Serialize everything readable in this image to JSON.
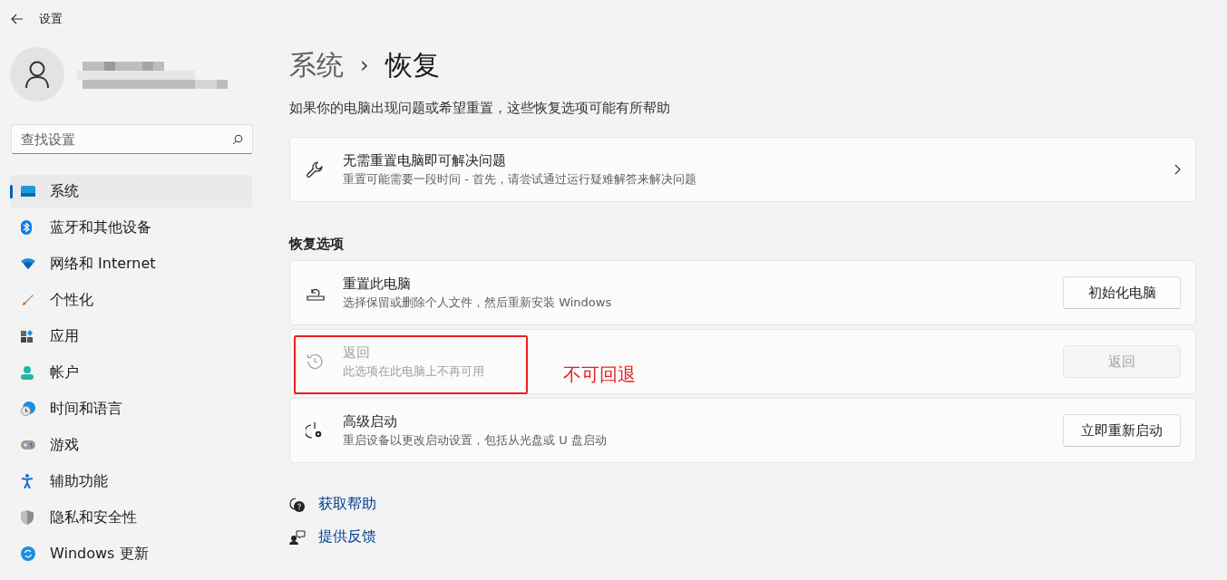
{
  "window": {
    "title": "设置"
  },
  "sidebar": {
    "search": {
      "placeholder": "查找设置"
    },
    "items": [
      {
        "label": "系统",
        "selected": true
      },
      {
        "label": "蓝牙和其他设备",
        "selected": false
      },
      {
        "label": "网络和 Internet",
        "selected": false
      },
      {
        "label": "个性化",
        "selected": false
      },
      {
        "label": "应用",
        "selected": false
      },
      {
        "label": "帐户",
        "selected": false
      },
      {
        "label": "时间和语言",
        "selected": false
      },
      {
        "label": "游戏",
        "selected": false
      },
      {
        "label": "辅助功能",
        "selected": false
      },
      {
        "label": "隐私和安全性",
        "selected": false
      },
      {
        "label": "Windows 更新",
        "selected": false
      }
    ]
  },
  "breadcrumb": {
    "parent": "系统",
    "separator": "›",
    "current": "恢复"
  },
  "description": "如果你的电脑出现问题或希望重置，这些恢复选项可能有所帮助",
  "fix_card": {
    "title": "无需重置电脑即可解决问题",
    "subtitle": "重置可能需要一段时间 - 首先，请尝试通过运行疑难解答来解决问题"
  },
  "section_title": "恢复选项",
  "options": [
    {
      "title": "重置此电脑",
      "subtitle": "选择保留或删除个人文件，然后重新安装 Windows",
      "button": "初始化电脑",
      "disabled": false
    },
    {
      "title": "返回",
      "subtitle": "此选项在此电脑上不再可用",
      "button": "返回",
      "disabled": true,
      "annotation": "不可回退"
    },
    {
      "title": "高级启动",
      "subtitle": "重启设备以更改启动设置，包括从光盘或 U 盘启动",
      "button": "立即重新启动",
      "disabled": false
    }
  ],
  "links": [
    "获取帮助",
    "提供反馈"
  ]
}
